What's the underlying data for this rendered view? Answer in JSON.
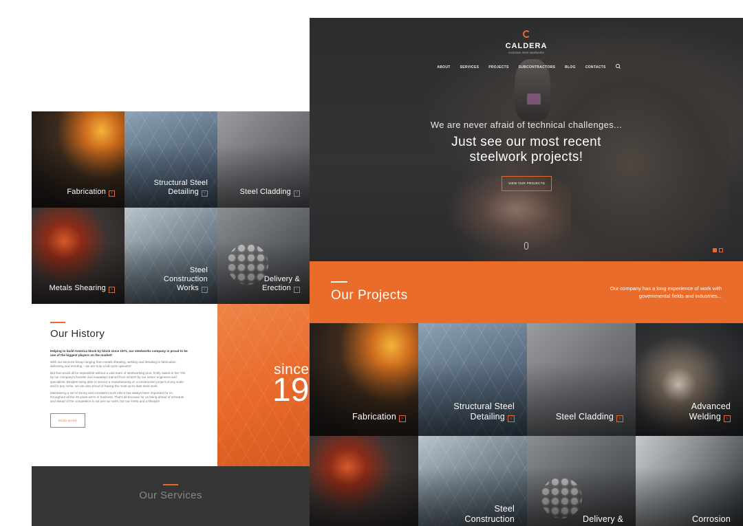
{
  "back_page": {
    "tiles": [
      {
        "line1": "Fabrication",
        "line2": ""
      },
      {
        "line1": "Structural Steel",
        "line2": "Detailing"
      },
      {
        "line1": "Steel Cladding",
        "line2": ""
      },
      {
        "line1": "Metals Shearing",
        "line2": ""
      },
      {
        "line1": "Steel",
        "line2": "Construction",
        "line3": "Works"
      },
      {
        "line1": "Delivery &",
        "line2": "Erection"
      }
    ],
    "history": {
      "title": "Our History",
      "lead": "Helping to build America block by block since 1971, our steelworks company is proud to be one of the biggest players on the market!",
      "p1": "With our services lineup ranging from metals shearing, welding and detailing to fabrication, delivering and erecting – we are truly a full-cycle operator!",
      "p2": "But that would all be impossible without a vast team of steelworking pros, firstly raised in the '70s by our company's founder and nowadays trained from scratch by our senior engineers and specialists. Besides being able to service a manufacturing or a construction project of any scale and in any niche, we are also proud of having the most up-to-date steel work.",
      "p3": "Maintaining a set of strong and consistent work ethics has always been important for us, throughout all the 45 years we're in business. That's all because for us being ahead of schedule and ahead of the competition is not just our work, but our motto and a lifestyle!",
      "button": "READ MORE"
    },
    "since": {
      "word": "since",
      "year": "19"
    },
    "services_title": "Our Services"
  },
  "front_page": {
    "logo": {
      "name": "CALDERA",
      "tagline": "exclusive steel steelworks"
    },
    "nav": [
      "ABOUT",
      "SERVICES",
      "PROJECTS",
      "SUBCONTRACTORS",
      "BLOG",
      "CONTACTS"
    ],
    "hero": {
      "subtitle": "We are never afraid of technical challenges...",
      "headline": "Just see our most recent steelwork projects!",
      "cta": "VIEW OUR PROJECTS"
    },
    "projects": {
      "title": "Our Projects",
      "text": "Our company has a long experience of work with governmental fields and industries..."
    },
    "tiles": [
      {
        "line1": "Fabrication",
        "line2": ""
      },
      {
        "line1": "Structural Steel",
        "line2": "Detailing"
      },
      {
        "line1": "Steel Cladding",
        "line2": ""
      },
      {
        "line1": "Advanced",
        "line2": "Welding"
      },
      {
        "line1": "",
        "line2": ""
      },
      {
        "line1": "Steel",
        "line2": "Construction"
      },
      {
        "line1": "Delivery &",
        "line2": ""
      },
      {
        "line1": "Corrosion",
        "line2": ""
      }
    ]
  },
  "colors": {
    "accent": "#e8692a",
    "dark": "#363636"
  }
}
